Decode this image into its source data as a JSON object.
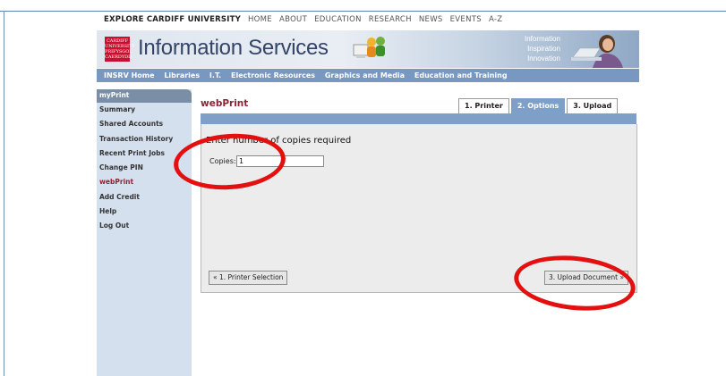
{
  "topnav": {
    "brand": "EXPLORE CARDIFF UNIVERSITY",
    "links": [
      "HOME",
      "ABOUT",
      "EDUCATION",
      "RESEARCH",
      "NEWS",
      "EVENTS",
      "A-Z"
    ]
  },
  "banner": {
    "logo_lines": [
      "CARDIFF",
      "UNIVERSITY",
      "PRIFYSGOL",
      "CAERDYDD"
    ],
    "title": "Information Services",
    "tagline": [
      "Information",
      "Inspiration",
      "Innovation"
    ]
  },
  "mainnav": {
    "items": [
      "INSRV Home",
      "Libraries",
      "I.T.",
      "Electronic Resources",
      "Graphics and Media",
      "Education and Training"
    ]
  },
  "sidebar": {
    "header": "myPrint",
    "items": [
      "Summary",
      "Shared Accounts",
      "Transaction History",
      "Recent Print Jobs",
      "Change PIN",
      "webPrint",
      "Add Credit",
      "Help",
      "Log Out"
    ],
    "active_index": 5
  },
  "page": {
    "title": "webPrint",
    "tabs": [
      "1. Printer",
      "2. Options",
      "3. Upload"
    ],
    "active_tab": 1,
    "heading": "Enter number of copies required",
    "copies_label": "Copies:",
    "copies_value": "1",
    "prev_button": "« 1. Printer Selection",
    "next_button": "3. Upload Document »"
  },
  "colors": {
    "accent": "#7d9fc8",
    "title_red": "#8a2432",
    "annotation_red": "#e3100f"
  }
}
